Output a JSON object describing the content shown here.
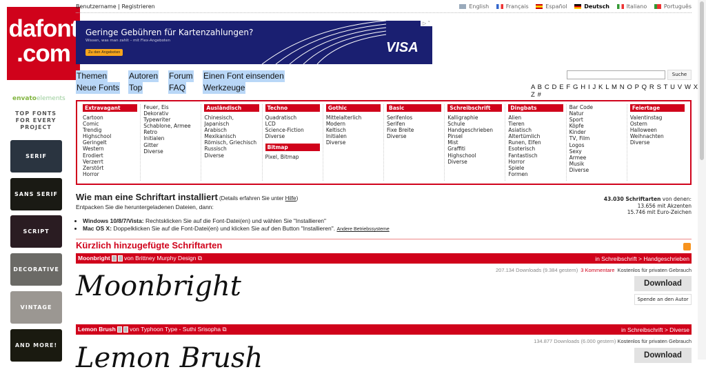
{
  "logo": {
    "line1": "dafont",
    ".com": ".com"
  },
  "sidebar": {
    "envato": "envato",
    "envato2": "elements",
    "top_fonts": "TOP FONTS FOR EVERY PROJECT",
    "tiles": [
      "SERIF",
      "SANS SERIF",
      "SCRIPT",
      "DECORATIVE",
      "VINTAGE",
      "AND MORE!"
    ]
  },
  "topbar": {
    "username": "Benutzername",
    "sep": "|",
    "register": "Registrieren",
    "languages": [
      {
        "label": "English",
        "bold": false
      },
      {
        "label": "Français",
        "bold": false
      },
      {
        "label": "Español",
        "bold": false
      },
      {
        "label": "Deutsch",
        "bold": true
      },
      {
        "label": "Italiano",
        "bold": false
      },
      {
        "label": "Português",
        "bold": false
      }
    ]
  },
  "ad": {
    "headline": "Geringe Gebühren für Kartenzahlungen?",
    "sub": "Wissen, was man zahlt – mit Flex-Angeboten",
    "button": "Zu den Angeboten",
    "brand": "VISA",
    "choices": "▷ ˅"
  },
  "nav": {
    "themen": "Themen",
    "neue": "Neue Fonts",
    "autoren": "Autoren",
    "top": "Top",
    "forum": "Forum",
    "faq": "FAQ",
    "einsenden": "Einen Font einsenden",
    "werkzeuge": "Werkzeuge"
  },
  "search": {
    "value": "",
    "button": "Suche"
  },
  "alphabet": "A B C D E F G H I J K L M N O P Q R S T U V W X Y Z #",
  "categories": [
    {
      "title": "Extravagant",
      "items": [
        "Cartoon",
        "Comic",
        "Trendig",
        "Highschool",
        "Geringelt",
        "Western",
        "Erodiert",
        "Verzerrt",
        "Zerstört",
        "Horror"
      ]
    },
    {
      "title": "",
      "items": [
        "Feuer, Eis",
        "Dekorativ",
        "Typewriter",
        "Schablone, Armee",
        "Retro",
        "Initialen",
        "Gitter",
        "Diverse"
      ]
    },
    {
      "title": "Ausländisch",
      "items": [
        "Chinesisch, Japanisch",
        "Arabisch",
        "Mexikanisch",
        "Römisch, Griechisch",
        "Russisch",
        "Diverse"
      ]
    },
    {
      "title": "Techno",
      "items": [
        "Quadratisch",
        "LCD",
        "Science-Fiction",
        "Diverse"
      ],
      "title2": "Bitmap",
      "items2": [
        "Pixel, Bitmap"
      ]
    },
    {
      "title": "Gothic",
      "items": [
        "Mittelalterlich",
        "Modern",
        "Keltisch",
        "Initialen",
        "Diverse"
      ]
    },
    {
      "title": "Basic",
      "items": [
        "Serifenlos",
        "Serifen",
        "Fixe Breite",
        "Diverse"
      ]
    },
    {
      "title": "Schreibschrift",
      "items": [
        "Kalligraphie",
        "Schule",
        "Handgeschrieben",
        "Pinsel",
        "Mist",
        "Graffiti",
        "Highschool",
        "Diverse"
      ]
    },
    {
      "title": "Dingbats",
      "items": [
        "Alien",
        "Tieren",
        "Asiatisch",
        "Altertümlich",
        "Runen, Elfen",
        "Esoterisch",
        "Fantastisch",
        "Horror",
        "Spiele",
        "Formen"
      ]
    },
    {
      "title": "",
      "items": [
        "Bar Code",
        "Natur",
        "Sport",
        "Köpfe",
        "Kinder",
        "TV, Film",
        "Logos",
        "Sexy",
        "Armee",
        "Musik",
        "Diverse"
      ]
    },
    {
      "title": "Feiertage",
      "items": [
        "Valentinstag",
        "Ostern",
        "Halloween",
        "Weihnachten",
        "Diverse"
      ]
    }
  ],
  "install": {
    "title": "Wie man eine Schriftart installiert",
    "details_pre": "(Details erfahren Sie unter ",
    "help": "Hilfe",
    "details_post": ")",
    "intro": "Entpacken Sie die heruntergeladenen Dateien, dann:",
    "win_label": "Windows 10/8/7/Vista:",
    "win_text": " Rechtsklicken Sie auf die Font-Datei(en) und wählen Sie \"Installieren\"",
    "mac_label": "Mac OS X:",
    "mac_text": " Doppelklicken Sie auf die Font-Datei(en) und klicken Sie auf den Button \"Installieren\".",
    "other": "Andere Betriebssysteme"
  },
  "stats": {
    "count": "43.030 Schriftarten",
    "suffix": " von denen:",
    "accents": "13.656 mit Akzenten",
    "euro": "15.746 mit Euro-Zeichen"
  },
  "recent_title": "Kürzlich hinzugefügte Schriftarten",
  "fonts": [
    {
      "name": "Moonbright",
      "by": "von Brittney Murphy Design",
      "category": "in Schreibschrift > Handgeschrieben",
      "downloads": "207.134 Downloads (9.384 gestern)",
      "comments": "3 Kommentare",
      "license": "Kostenlos für privaten Gebrauch",
      "download": "Download",
      "donate": "Spende an den Autor",
      "preview": "Moonbright"
    },
    {
      "name": "Lemon Brush",
      "by": "von Typhoon Type - Suthi Srisopha",
      "category": "in Schreibschrift > Diverse",
      "downloads": "134.877 Downloads (6.000 gestern)",
      "license": "Kostenlos für privaten Gebrauch",
      "download": "Download",
      "preview": "Lemon Brush"
    }
  ],
  "colors": {
    "brand": "#d0021b",
    "ad_bg": "#1a1f71",
    "nav_highlight": "#b9d7f7"
  }
}
